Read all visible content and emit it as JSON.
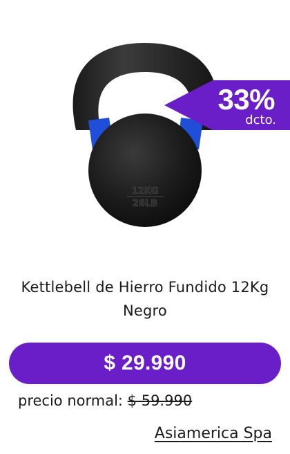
{
  "badge": {
    "percent": "33%",
    "label": "dcto.",
    "color": "#6a1ec8"
  },
  "product": {
    "image_icon": "kettlebell-image",
    "embossed_weight_kg": "12KG",
    "embossed_weight_lb": "26LB",
    "name": "Kettlebell de Hierro Fundido 12Kg Negro"
  },
  "price": {
    "current": "$ 29.990",
    "regular_label": "precio normal:",
    "regular_value": "$ 59.990"
  },
  "seller": {
    "name": "Asiamerica Spa"
  },
  "colors": {
    "accent": "#6a1ec8",
    "text": "#1b1b1b",
    "background": "#ffffff"
  }
}
